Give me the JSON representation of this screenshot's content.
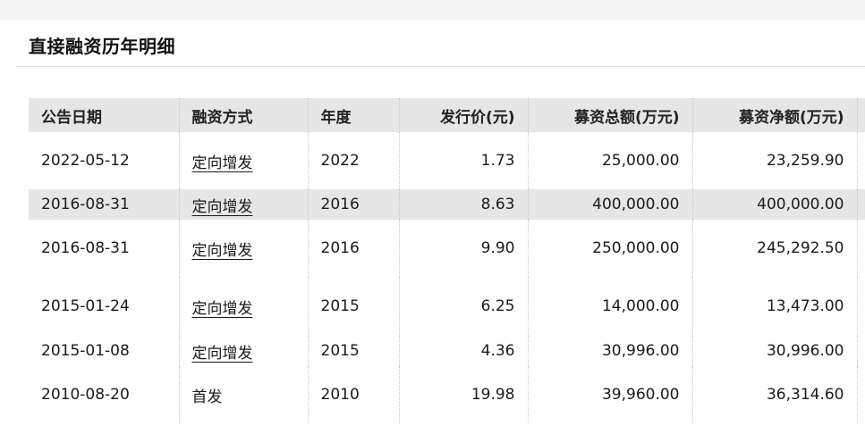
{
  "panel": {
    "title": "直接融资历年明细"
  },
  "table": {
    "headers": {
      "date": "公告日期",
      "method": "融资方式",
      "year": "年度",
      "price": "发行价(元)",
      "gross": "募资总额(万元)",
      "net": "募资净额(万元)"
    },
    "rows": [
      {
        "date": "2022-05-12",
        "method": "定向增发",
        "year": "2022",
        "price": "1.73",
        "gross": "25,000.00",
        "net": "23,259.90"
      },
      {
        "date": "2016-08-31",
        "method": "定向增发",
        "year": "2016",
        "price": "8.63",
        "gross": "400,000.00",
        "net": "400,000.00"
      },
      {
        "date": "2016-08-31",
        "method": "定向增发",
        "year": "2016",
        "price": "9.90",
        "gross": "250,000.00",
        "net": "245,292.50"
      },
      {
        "date": "2015-01-24",
        "method": "定向增发",
        "year": "2015",
        "price": "6.25",
        "gross": "14,000.00",
        "net": "13,473.00"
      },
      {
        "date": "2015-01-08",
        "method": "定向增发",
        "year": "2015",
        "price": "4.36",
        "gross": "30,996.00",
        "net": "30,996.00"
      },
      {
        "date": "2010-08-20",
        "method": "首发",
        "year": "2010",
        "price": "19.98",
        "gross": "39,960.00",
        "net": "36,314.60"
      }
    ]
  }
}
